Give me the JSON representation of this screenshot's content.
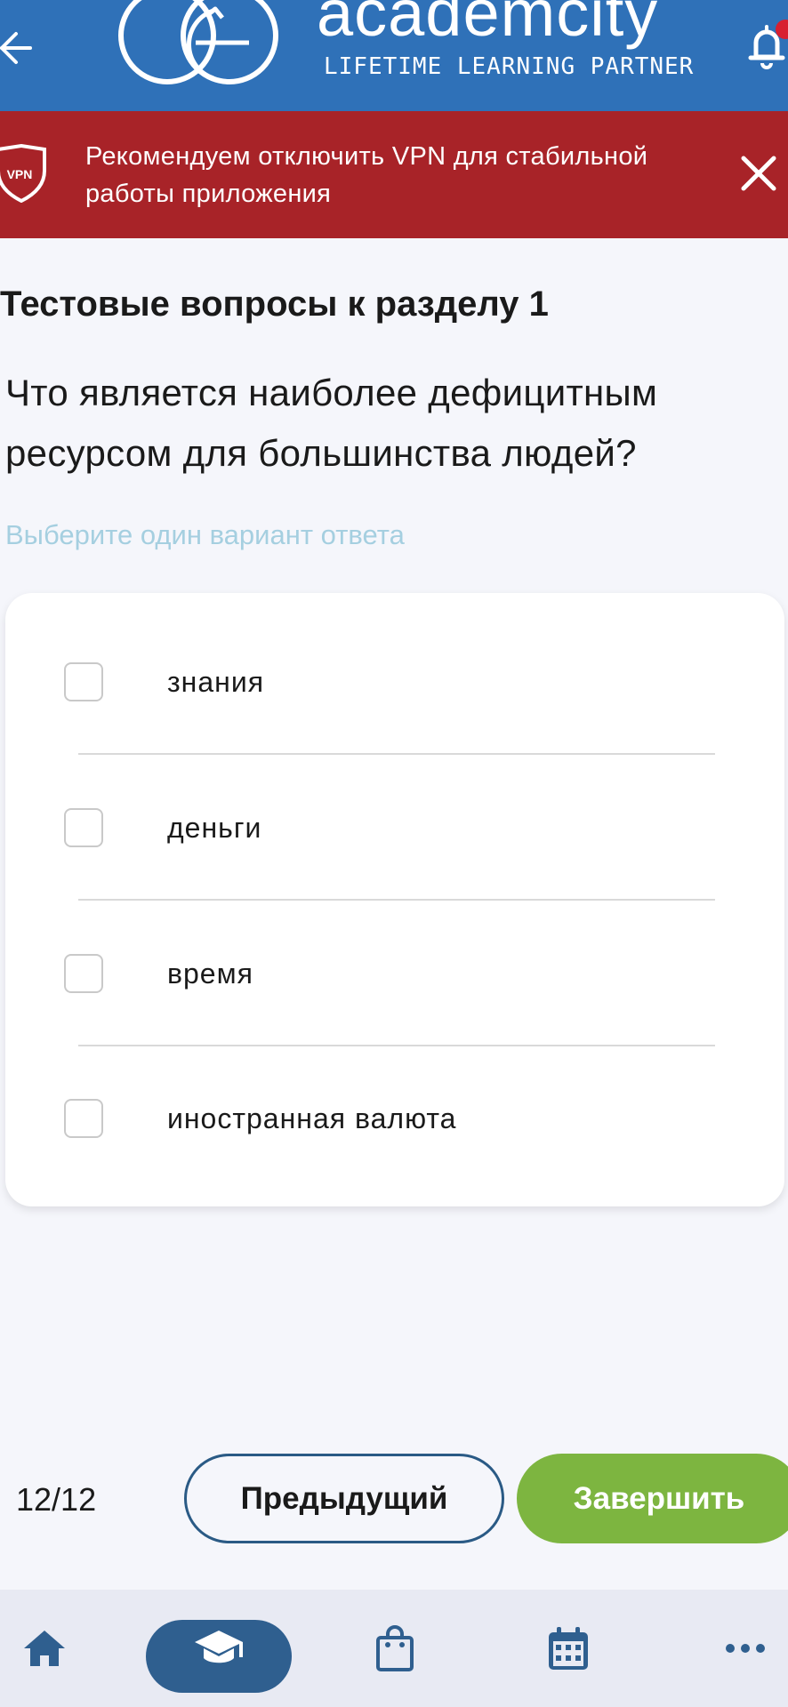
{
  "header": {
    "logo_name": "academcity",
    "logo_tagline": "LIFETIME LEARNING PARTNER"
  },
  "vpn_banner": {
    "shield_label": "VPN",
    "message": "Рекомендуем отключить VPN для стабильной работы приложения"
  },
  "quiz": {
    "section_title": "Тестовые вопросы к разделу 1",
    "question": "Что является наиболее дефицитным ресурсом для большинства людей?",
    "hint": "Выберите один вариант ответа",
    "options": [
      {
        "label": "знания",
        "checked": false
      },
      {
        "label": "деньги",
        "checked": false
      },
      {
        "label": "время",
        "checked": false
      },
      {
        "label": "иностранная валюта",
        "checked": false
      }
    ],
    "progress": "12/12",
    "prev_label": "Предыдущий",
    "finish_label": "Завершить"
  },
  "colors": {
    "header_bg": "#2f71b8",
    "banner_bg": "#a82328",
    "finish_bg": "#7db540",
    "prev_border": "#2a5a85",
    "nav_active": "#2f5f8f",
    "nav_icon": "#2f5f8f"
  },
  "bottom_nav": [
    {
      "icon": "home-icon",
      "active": false
    },
    {
      "icon": "graduation-cap-icon",
      "active": true
    },
    {
      "icon": "shopping-bag-icon",
      "active": false
    },
    {
      "icon": "calendar-icon",
      "active": false
    },
    {
      "icon": "more-dots-icon",
      "active": false
    }
  ]
}
